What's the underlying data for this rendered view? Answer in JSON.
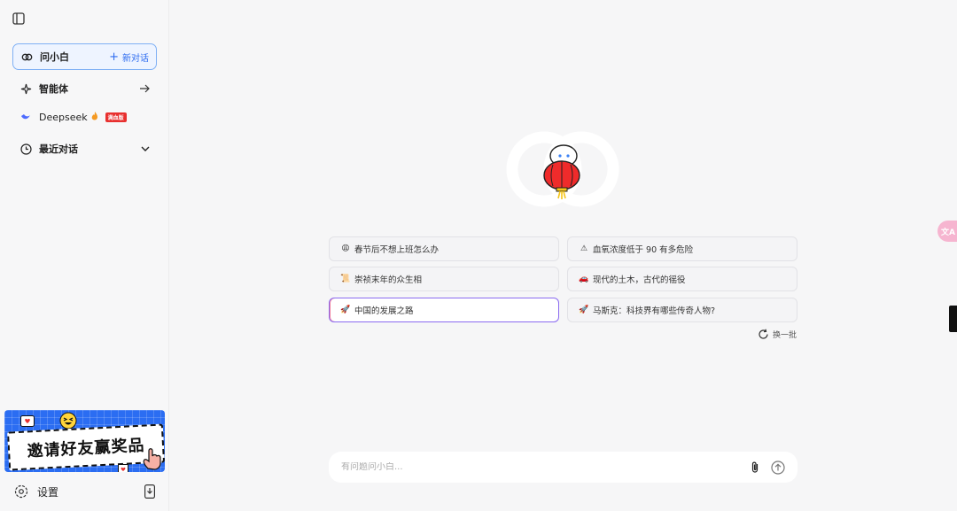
{
  "sidebar": {
    "nav": {
      "ask": {
        "label": "问小白",
        "new_chat": "新对话"
      },
      "agents": {
        "label": "智能体"
      },
      "deepseek": {
        "label": "Deepseek",
        "badge": "满血版"
      },
      "recent": {
        "label": "最近对话"
      }
    },
    "banner": {
      "text": "邀请好友赢奖品"
    },
    "settings": {
      "label": "设置"
    }
  },
  "main": {
    "suggestions": [
      {
        "emoji": "😩",
        "text": "春节后不想上班怎么办"
      },
      {
        "emoji": "⚠",
        "text": "血氧浓度低于 90 有多危险"
      },
      {
        "emoji": "📜",
        "text": "崇祯末年的众生相"
      },
      {
        "emoji": "🚗",
        "text": "现代的土木，古代的徭役"
      },
      {
        "emoji": "🚀",
        "text": "中国的发展之路"
      },
      {
        "emoji": "🚀",
        "text": "马斯克：科技界有哪些传奇人物?"
      }
    ],
    "refresh_label": "换一批",
    "input": {
      "placeholder": "有问题问小白..."
    }
  },
  "colors": {
    "accent": "#2f6df0",
    "badge": "#e8302f",
    "banner": "#2b6df2",
    "highlight_border": "#8a6af0"
  }
}
